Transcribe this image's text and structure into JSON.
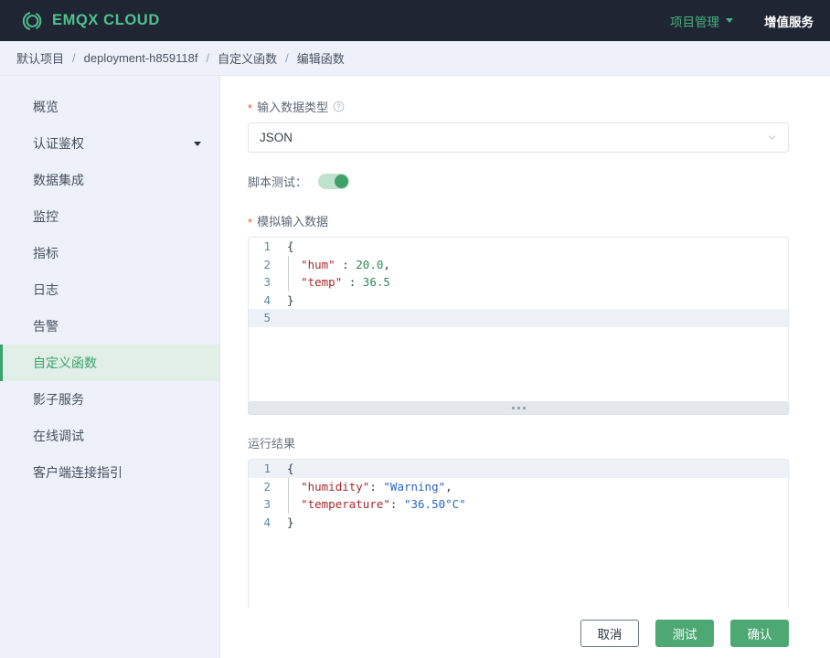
{
  "topbar": {
    "brand": "EMQX CLOUD",
    "logo_icon": "emqx-logo-icon",
    "project_menu": "项目管理",
    "value_added_service": "增值服务"
  },
  "breadcrumb": {
    "separator": "/",
    "items": [
      {
        "label": "默认项目"
      },
      {
        "label": "deployment-h859118f"
      },
      {
        "label": "自定义函数"
      },
      {
        "label": "编辑函数"
      }
    ]
  },
  "sidebar": {
    "items": [
      {
        "label": "概览",
        "active": false,
        "has_caret": false
      },
      {
        "label": "认证鉴权",
        "active": false,
        "has_caret": true
      },
      {
        "label": "数据集成",
        "active": false,
        "has_caret": false
      },
      {
        "label": "监控",
        "active": false,
        "has_caret": false
      },
      {
        "label": "指标",
        "active": false,
        "has_caret": false
      },
      {
        "label": "日志",
        "active": false,
        "has_caret": false
      },
      {
        "label": "告警",
        "active": false,
        "has_caret": false
      },
      {
        "label": "自定义函数",
        "active": true,
        "has_caret": false
      },
      {
        "label": "影子服务",
        "active": false,
        "has_caret": false
      },
      {
        "label": "在线调试",
        "active": false,
        "has_caret": false
      },
      {
        "label": "客户端连接指引",
        "active": false,
        "has_caret": false
      }
    ]
  },
  "form": {
    "input_type": {
      "required_mark": "*",
      "label": "输入数据类型",
      "help_icon": "question-circle-icon",
      "selected": "JSON",
      "options": [
        "JSON"
      ],
      "chevron_icon": "chevron-down-icon"
    },
    "script_test": {
      "label": "脚本测试：",
      "enabled": true
    },
    "mock_input": {
      "required_mark": "*",
      "label": "模拟输入数据",
      "active_line": 5,
      "lines": [
        {
          "no": "1",
          "tokens": [
            {
              "t": "{",
              "c": "punct"
            }
          ]
        },
        {
          "no": "2",
          "tokens": [
            {
              "t": "  ",
              "c": "punct"
            },
            {
              "t": "\"hum\"",
              "c": "key"
            },
            {
              "t": " : ",
              "c": "punct"
            },
            {
              "t": "20.0",
              "c": "num"
            },
            {
              "t": ",",
              "c": "punct"
            }
          ]
        },
        {
          "no": "3",
          "tokens": [
            {
              "t": "  ",
              "c": "punct"
            },
            {
              "t": "\"temp\"",
              "c": "key"
            },
            {
              "t": " : ",
              "c": "punct"
            },
            {
              "t": "36.5",
              "c": "num"
            }
          ]
        },
        {
          "no": "4",
          "tokens": [
            {
              "t": "}",
              "c": "punct"
            }
          ]
        },
        {
          "no": "5",
          "tokens": [
            {
              "t": "",
              "c": "punct"
            }
          ]
        }
      ]
    },
    "result": {
      "label": "运行结果",
      "active_line": 1,
      "lines": [
        {
          "no": "1",
          "tokens": [
            {
              "t": "{",
              "c": "punct"
            }
          ]
        },
        {
          "no": "2",
          "tokens": [
            {
              "t": "  ",
              "c": "punct"
            },
            {
              "t": "\"humidity\"",
              "c": "key"
            },
            {
              "t": ": ",
              "c": "punct"
            },
            {
              "t": "\"Warning\"",
              "c": "str"
            },
            {
              "t": ",",
              "c": "punct"
            }
          ]
        },
        {
          "no": "3",
          "tokens": [
            {
              "t": "  ",
              "c": "punct"
            },
            {
              "t": "\"temperature\"",
              "c": "key"
            },
            {
              "t": ": ",
              "c": "punct"
            },
            {
              "t": "\"36.50°C\"",
              "c": "str"
            }
          ]
        },
        {
          "no": "4",
          "tokens": [
            {
              "t": "}",
              "c": "punct"
            }
          ]
        }
      ]
    }
  },
  "footer": {
    "cancel": "取消",
    "test": "测试",
    "confirm": "确认"
  },
  "colors": {
    "brand_green": "#4ec18f",
    "accent_green": "#4da873",
    "topbar_bg": "#1f2533",
    "sidebar_bg": "#eef1f9",
    "required_star": "#f05a28"
  }
}
